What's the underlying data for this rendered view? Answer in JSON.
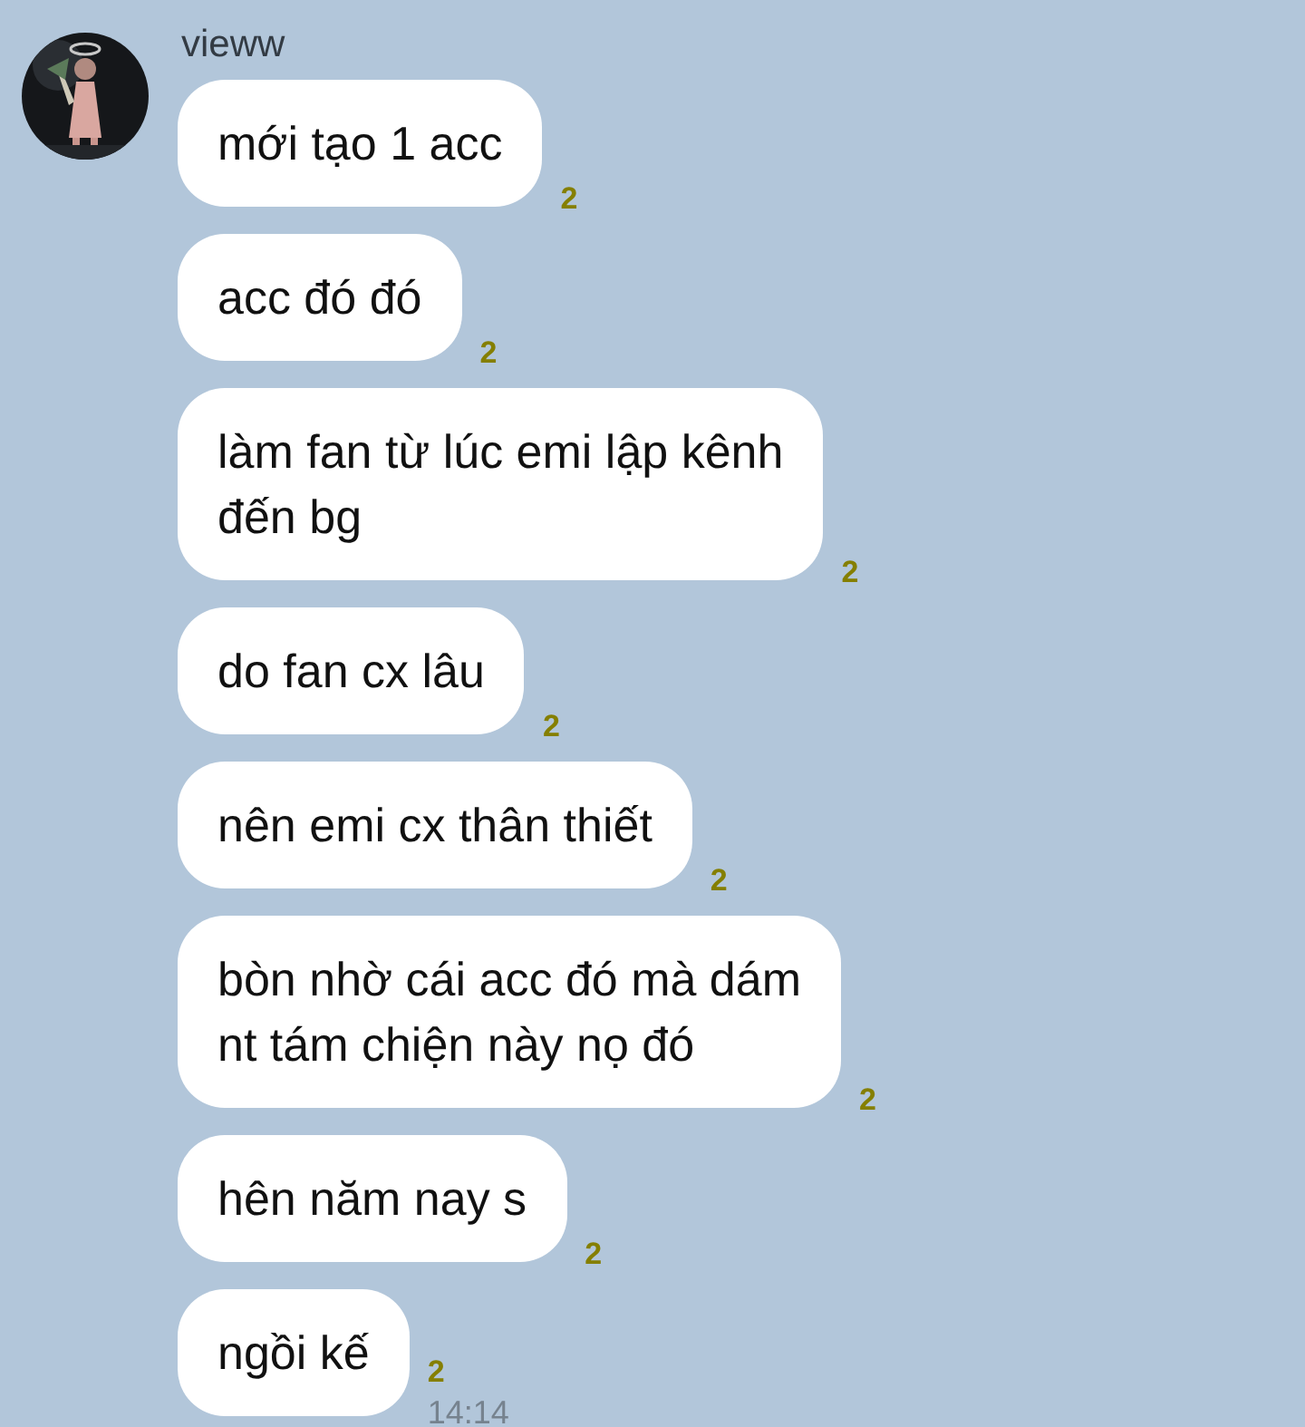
{
  "sender": {
    "name": "vieww"
  },
  "messages": [
    {
      "text": "mới tạo 1 acc",
      "read": "2"
    },
    {
      "text": "acc đó đó",
      "read": "2"
    },
    {
      "text": "làm fan từ lúc emi lập kênh\nđến bg",
      "read": "2"
    },
    {
      "text": "do fan cx lâu",
      "read": "2"
    },
    {
      "text": "nên emi cx thân thiết",
      "read": "2"
    },
    {
      "text": "bòn nhờ cái acc đó mà dám\nnt tám chiện này nọ đó",
      "read": "2"
    },
    {
      "text": "hên năm nay s",
      "read": "2"
    },
    {
      "text": "ngồi kế",
      "read": "2",
      "time": "14:14"
    }
  ]
}
